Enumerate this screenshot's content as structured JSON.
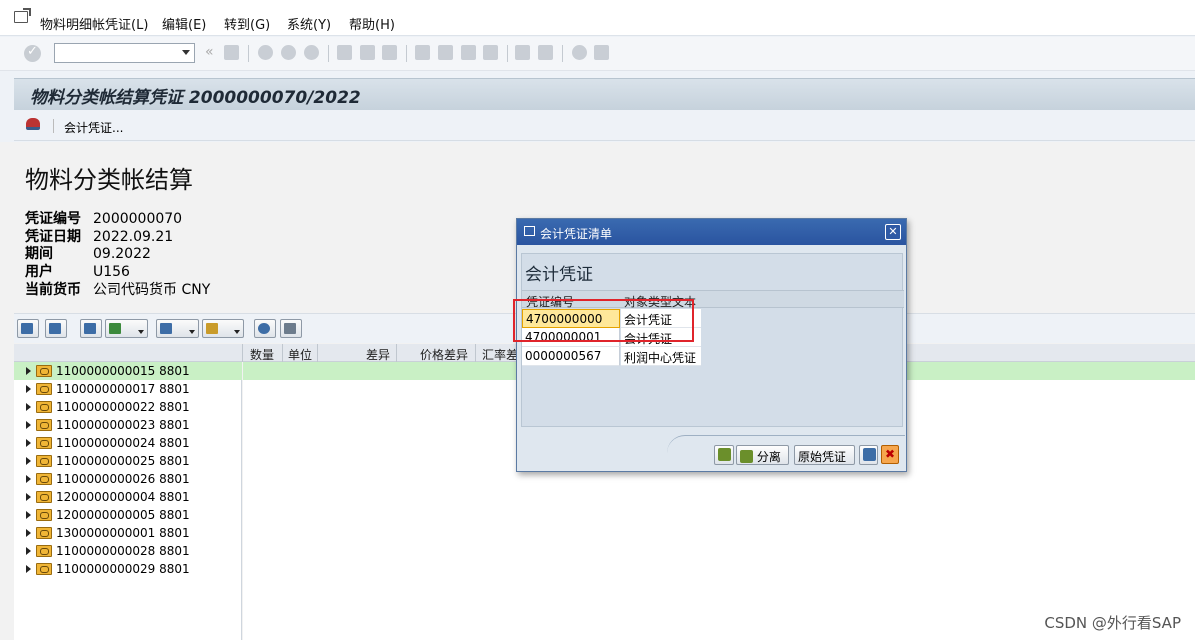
{
  "menubar": {
    "items": [
      "物料明细帐凭证(L)",
      "编辑(E)",
      "转到(G)",
      "系统(Y)",
      "帮助(H)"
    ]
  },
  "toolbar": {
    "command_value": "",
    "nav_symbol": "«"
  },
  "title": "物料分类帐结算凭证 2000000070/2022",
  "appbar": {
    "accounting_doc_button": "会计凭证..."
  },
  "header": {
    "heading": "物料分类帐结算",
    "fields": [
      {
        "label": "凭证编号",
        "value": "2000000070"
      },
      {
        "label": "凭证日期",
        "value": "2022.09.21"
      },
      {
        "label": "期间",
        "value": "09.2022"
      },
      {
        "label": "用户",
        "value": "U156"
      },
      {
        "label": "当前货币",
        "value": "公司代码货币 CNY"
      }
    ]
  },
  "grid": {
    "columns": [
      "数量",
      "单位",
      "差异",
      "价格差异",
      "汇率差"
    ],
    "nodes": [
      "1100000000015 8801",
      "1100000000017 8801",
      "1100000000022 8801",
      "1100000000023 8801",
      "1100000000024 8801",
      "1100000000025 8801",
      "1100000000026 8801",
      "1200000000004 8801",
      "1200000000005 8801",
      "1300000000001 8801",
      "1100000000028 8801",
      "1100000000029 8801"
    ]
  },
  "dialog": {
    "title": "会计凭证清单",
    "heading": "会计凭证",
    "columns": [
      "凭证编号",
      "对象类型文本"
    ],
    "rows": [
      {
        "doc": "4700000000",
        "type": "会计凭证"
      },
      {
        "doc": "4700000001",
        "type": "会计凭证"
      },
      {
        "doc": "0000000567",
        "type": "利润中心凭证"
      }
    ],
    "buttons": {
      "split": "分离",
      "original": "原始凭证"
    },
    "close_symbol": "✕",
    "cancel_symbol": "✖"
  },
  "watermark": "CSDN @外行看SAP",
  "colors": {
    "title_bar": "#c6d2dc",
    "selection": "#c9f0c5",
    "dialog_header": "#2a54a0",
    "highlight_box": "#e0242b"
  }
}
